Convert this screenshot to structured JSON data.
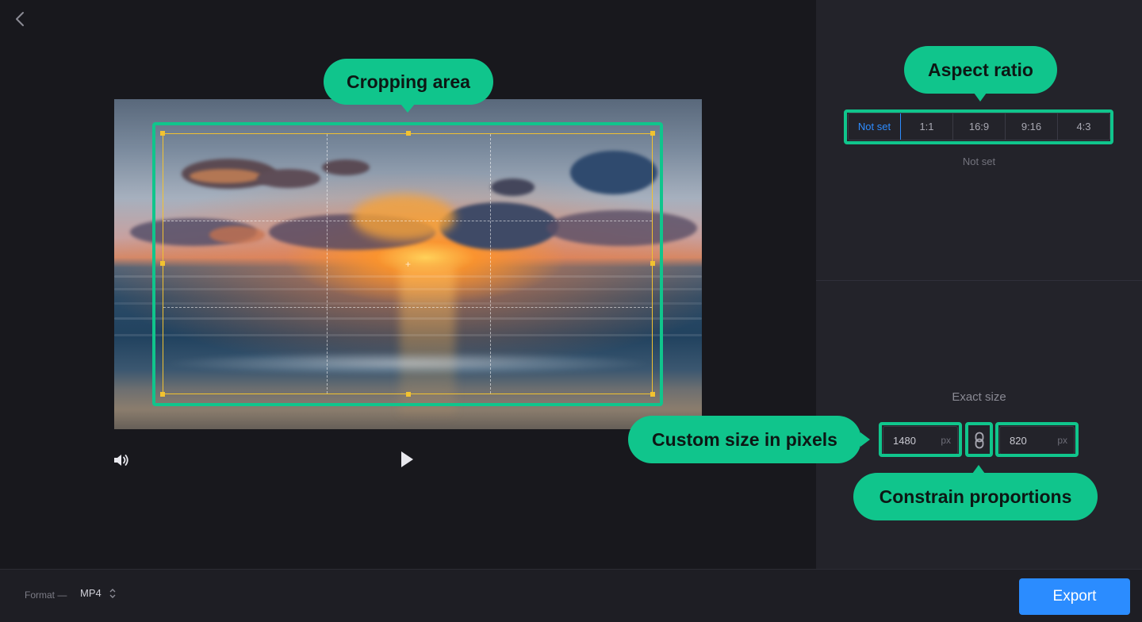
{
  "editor": {
    "back_icon": "chevron-left-icon",
    "controls": {
      "volume_icon": "volume-icon",
      "play_icon": "play-icon"
    }
  },
  "annotations": {
    "cropping_area": "Cropping area",
    "aspect_ratio": "Aspect ratio",
    "custom_size": "Custom size in pixels",
    "constrain": "Constrain proportions"
  },
  "panel": {
    "aspect_ratio": {
      "options": [
        "Not set",
        "1:1",
        "16:9",
        "9:16",
        "4:3"
      ],
      "selected": "Not set",
      "status": "Not set"
    },
    "exact_size": {
      "label": "Exact size",
      "width": "1480",
      "height": "820",
      "unit": "px",
      "link_icon": "link-icon"
    }
  },
  "bottombar": {
    "format_label": "Format —",
    "format_value": "MP4",
    "format_icon": "up-down-chevron-icon",
    "export_label": "Export"
  },
  "colors": {
    "accent_green": "#10c58c",
    "crop_yellow": "#f2c230",
    "primary_blue": "#2b8cff",
    "background": "#18181d",
    "panel": "#23232a"
  }
}
